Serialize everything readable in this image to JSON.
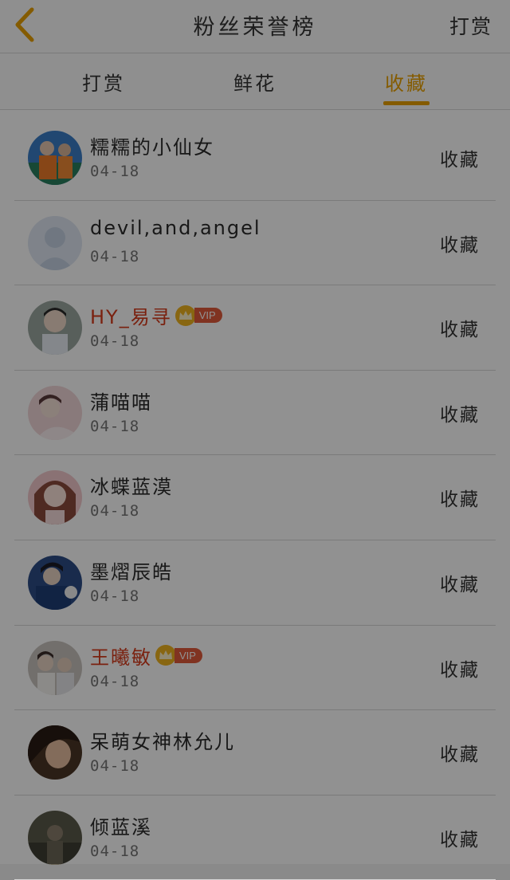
{
  "header": {
    "title": "粉丝荣誉榜",
    "action_label": "打赏"
  },
  "tabs": [
    {
      "label": "打赏",
      "active": false
    },
    {
      "label": "鲜花",
      "active": false
    },
    {
      "label": "收藏",
      "active": true
    }
  ],
  "accent_color": "#e8a000",
  "vip_name_color": "#d73a1c",
  "vip_label": "VIP",
  "list": [
    {
      "name": "糯糯的小仙女",
      "date": "04-18",
      "action": "收藏",
      "vip": false
    },
    {
      "name": "devil,and,angel",
      "date": "04-18",
      "action": "收藏",
      "vip": false
    },
    {
      "name": "HY_易寻",
      "date": "04-18",
      "action": "收藏",
      "vip": true
    },
    {
      "name": "蒲喵喵",
      "date": "04-18",
      "action": "收藏",
      "vip": false
    },
    {
      "name": "冰蝶蓝漠",
      "date": "04-18",
      "action": "收藏",
      "vip": false
    },
    {
      "name": "墨熠辰皓",
      "date": "04-18",
      "action": "收藏",
      "vip": false
    },
    {
      "name": "王曦敏",
      "date": "04-18",
      "action": "收藏",
      "vip": true
    },
    {
      "name": "呆萌女神林允儿",
      "date": "04-18",
      "action": "收藏",
      "vip": false
    },
    {
      "name": "倾蓝溪",
      "date": "04-18",
      "action": "收藏",
      "vip": false
    }
  ]
}
